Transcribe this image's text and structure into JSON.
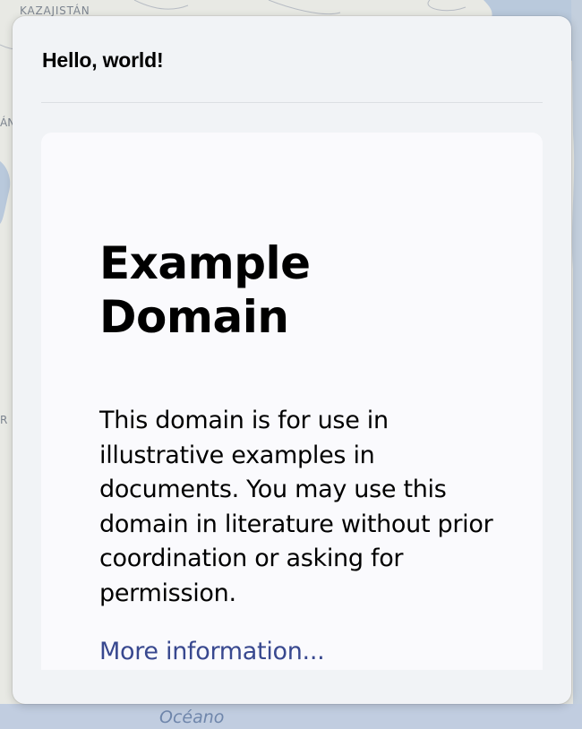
{
  "map": {
    "labels": {
      "country": "KAZAJISTÁN",
      "edge_a": "ÁN",
      "edge_r": "R",
      "ocean": "Océano"
    },
    "colors": {
      "land": "#e8e9e4",
      "water": "#b9c9dc",
      "border": "#b7bcc4"
    }
  },
  "panel": {
    "header": "Hello, world!"
  },
  "page": {
    "title": "Example Domain",
    "body": "This domain is for use in illustrative examples in documents. You may use this domain in literature without prior coordination or asking for permission.",
    "link_text": "More information..."
  },
  "colors": {
    "link": "#38488f",
    "panel_bg": "#f1f3f6",
    "frame_bg": "#fafafd"
  }
}
